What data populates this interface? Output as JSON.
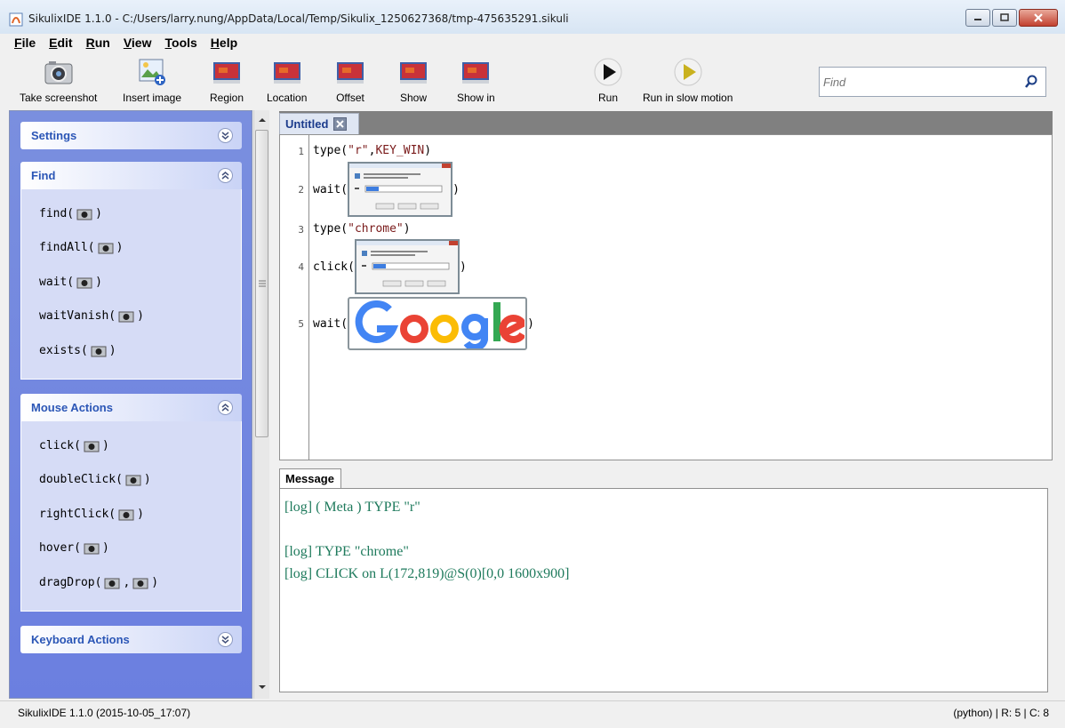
{
  "window": {
    "title": "SikulixIDE 1.1.0 - C:/Users/larry.nung/AppData/Local/Temp/Sikulix_1250627368/tmp-475635291.sikuli",
    "controls": [
      "minimize-icon",
      "maximize-icon",
      "close-icon"
    ]
  },
  "menu": [
    {
      "label": "File",
      "u": "F",
      "rest": "ile"
    },
    {
      "label": "Edit",
      "u": "E",
      "rest": "dit"
    },
    {
      "label": "Run",
      "u": "R",
      "rest": "un"
    },
    {
      "label": "View",
      "u": "V",
      "rest": "iew"
    },
    {
      "label": "Tools",
      "u": "T",
      "rest": "ools"
    },
    {
      "label": "Help",
      "u": "H",
      "rest": "elp"
    }
  ],
  "toolbar": {
    "take_screenshot": "Take screenshot",
    "insert_image": "Insert image",
    "region": "Region",
    "location": "Location",
    "offset": "Offset",
    "show": "Show",
    "show_in": "Show in",
    "run": "Run",
    "run_slow": "Run in slow motion",
    "find_placeholder": "Find"
  },
  "sidebar": {
    "settings": "Settings",
    "find": {
      "title": "Find",
      "items": [
        "find(",
        "findAll(",
        "wait(",
        "waitVanish(",
        "exists("
      ]
    },
    "mouse": {
      "title": "Mouse Actions",
      "items": [
        "click(",
        "doubleClick(",
        "rightClick(",
        "hover(",
        "dragDrop("
      ]
    },
    "keyboard": "Keyboard Actions"
  },
  "editor": {
    "tab": "Untitled",
    "lines": [
      {
        "n": "1",
        "fn": "type(",
        "arg": "\"r\"",
        "sep": ", ",
        "arg2": "KEY_WIN",
        "close": ")"
      },
      {
        "n": "2",
        "fn": "wait(",
        "close": ")"
      },
      {
        "n": "3",
        "fn": "type(",
        "arg": "\"chrome\"",
        "close": ")"
      },
      {
        "n": "4",
        "fn": "click(",
        "close": ")"
      },
      {
        "n": "5",
        "fn": "wait(",
        "close": ")"
      }
    ]
  },
  "message": {
    "tab": "Message",
    "logs": [
      "[log] ( Meta ) TYPE \"r\"",
      "[log] TYPE \"chrome\"",
      "[log] CLICK on L(172,819)@S(0)[0,0 1600x900]"
    ]
  },
  "status": {
    "left": "SikulixIDE 1.1.0 (2015-10-05_17:07)",
    "right": "(python) | R: 5 | C: 8"
  }
}
